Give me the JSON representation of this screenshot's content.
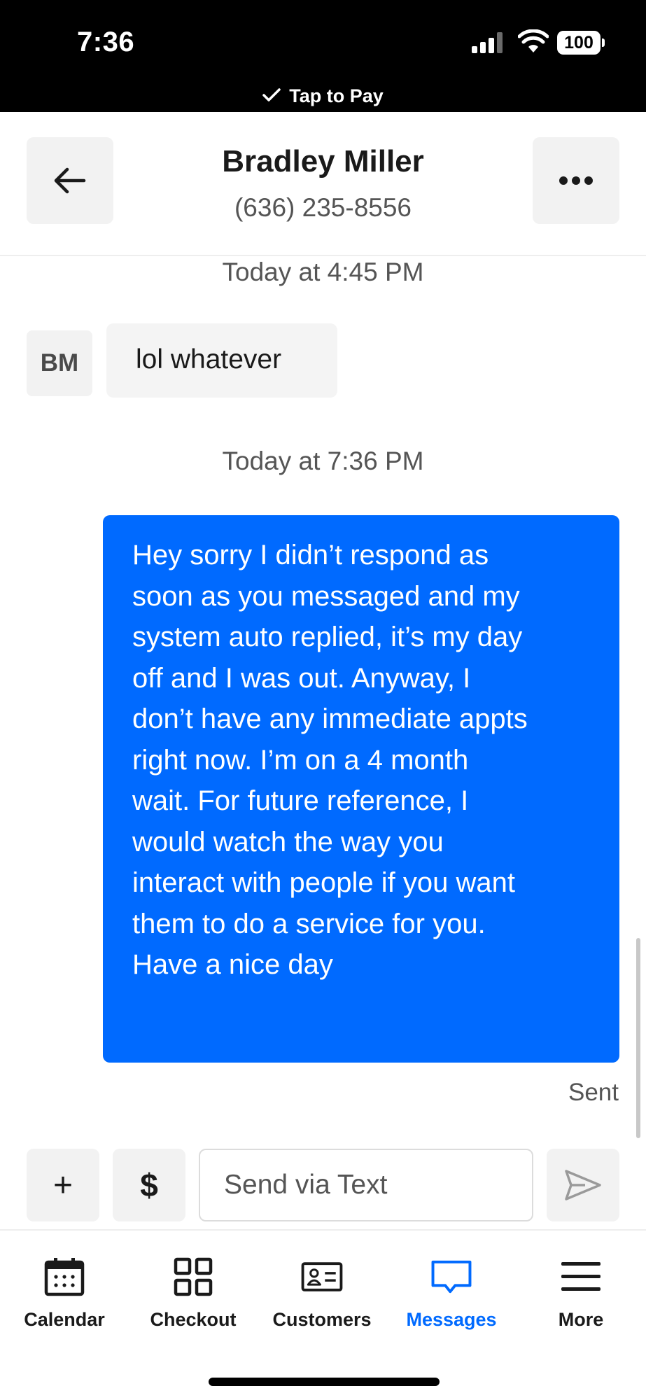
{
  "status_bar": {
    "time": "7:36",
    "battery": "100",
    "tap_to_pay": "Tap to Pay"
  },
  "header": {
    "contact_name": "Bradley Miller",
    "contact_phone": "(636) 235-8556"
  },
  "conversation": {
    "timestamp_1": "Today at 4:45 PM",
    "incoming": {
      "avatar_initials": "BM",
      "text": "lol whatever"
    },
    "timestamp_2": "Today at 7:36 PM",
    "outgoing": {
      "text": "Hey sorry I didn’t respond as\nsoon as you messaged and my\nsystem auto replied, it’s my day\noff and I was out. Anyway, I\ndon’t have any immediate appts\nright now. I’m on a 4 month\nwait. For future reference, I\nwould watch the way you\ninteract with people if you want\nthem to do a service for you.\nHave a nice day",
      "status": "Sent"
    }
  },
  "composer": {
    "add_label": "+",
    "money_label": "$",
    "input_placeholder": "Send via Text",
    "input_value": ""
  },
  "tabbar": {
    "items": [
      {
        "label": "Calendar",
        "icon": "calendar-icon",
        "active": false
      },
      {
        "label": "Checkout",
        "icon": "grid-icon",
        "active": false
      },
      {
        "label": "Customers",
        "icon": "contact-card-icon",
        "active": false
      },
      {
        "label": "Messages",
        "icon": "message-bubble-icon",
        "active": true
      },
      {
        "label": "More",
        "icon": "menu-icon",
        "active": false
      }
    ]
  },
  "colors": {
    "accent": "#006aff",
    "text": "#1a1a1a",
    "muted": "#555555",
    "surface": "#f2f2f2"
  }
}
